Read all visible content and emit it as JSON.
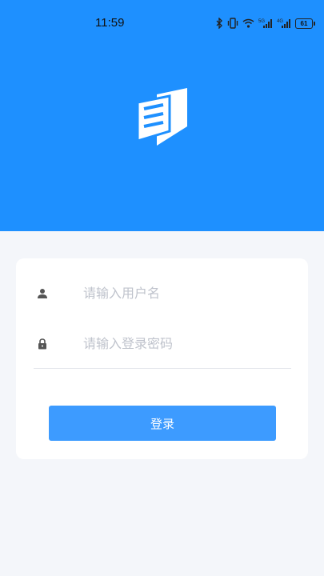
{
  "status_bar": {
    "time": "11:59",
    "battery_level": "61",
    "icons": [
      "bluetooth-icon",
      "vibrate-icon",
      "wifi-icon",
      "signal-5g-icon",
      "signal-4g-icon",
      "battery-icon"
    ]
  },
  "header": {
    "background_color": "#1e90ff",
    "logo_icon": "app-logo-icon"
  },
  "login_form": {
    "username": {
      "value": "",
      "placeholder": "请输入用户名",
      "icon": "user-icon"
    },
    "password": {
      "value": "",
      "placeholder": "请输入登录密码",
      "icon": "lock-icon"
    },
    "submit_label": "登录",
    "button_color": "#3d9bff"
  }
}
